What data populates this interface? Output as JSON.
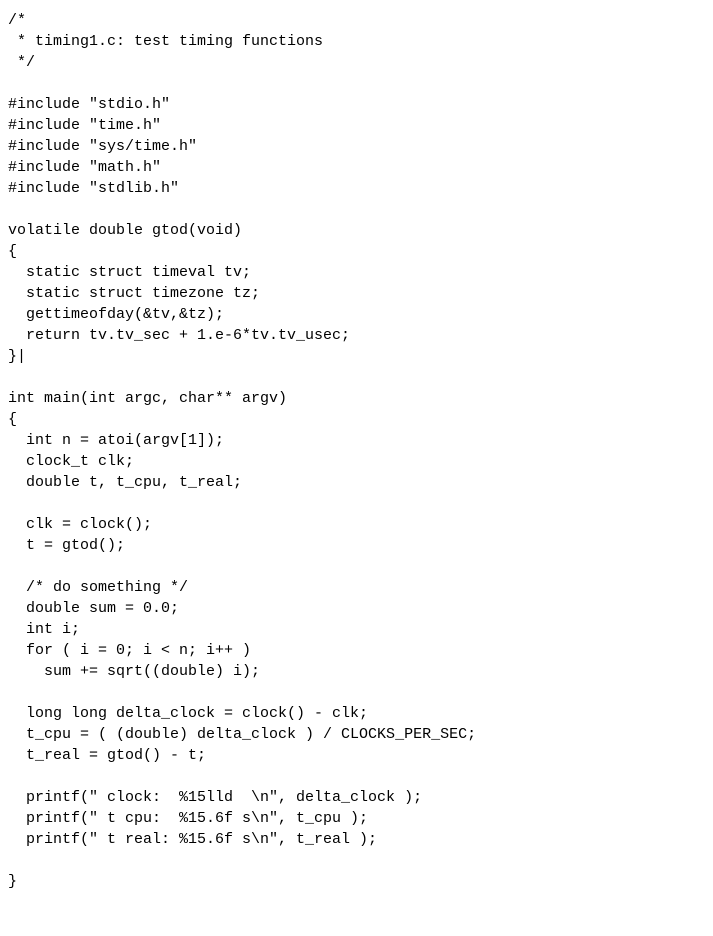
{
  "code": {
    "lines": [
      "/*",
      " * timing1.c: test timing functions",
      " */",
      "",
      "#include \"stdio.h\"",
      "#include \"time.h\"",
      "#include \"sys/time.h\"",
      "#include \"math.h\"",
      "#include \"stdlib.h\"",
      "",
      "volatile double gtod(void)",
      "{",
      "  static struct timeval tv;",
      "  static struct timezone tz;",
      "  gettimeofday(&tv,&tz);",
      "  return tv.tv_sec + 1.e-6*tv.tv_usec;",
      "}|",
      "",
      "int main(int argc, char** argv)",
      "{",
      "  int n = atoi(argv[1]);",
      "  clock_t clk;",
      "  double t, t_cpu, t_real;",
      "",
      "  clk = clock();",
      "  t = gtod();",
      "",
      "  /* do something */",
      "  double sum = 0.0;",
      "  int i;",
      "  for ( i = 0; i < n; i++ )",
      "    sum += sqrt((double) i);",
      "",
      "  long long delta_clock = clock() - clk;",
      "  t_cpu = ( (double) delta_clock ) / CLOCKS_PER_SEC;",
      "  t_real = gtod() - t;",
      "",
      "  printf(\" clock:  %15lld  \\n\", delta_clock );",
      "  printf(\" t cpu:  %15.6f s\\n\", t_cpu );",
      "  printf(\" t real: %15.6f s\\n\", t_real );",
      "",
      "}"
    ]
  }
}
